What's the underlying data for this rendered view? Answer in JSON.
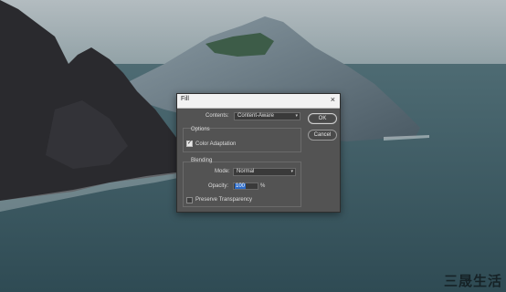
{
  "dialog": {
    "title": "Fill",
    "close_glyph": "×",
    "contents_label": "Contents:",
    "contents_value": "Content-Aware",
    "options_label": "Options",
    "color_adaptation_label": "Color Adaptation",
    "color_adaptation_checked": true,
    "blending_label": "Blending",
    "mode_label": "Mode:",
    "mode_value": "Normal",
    "opacity_label": "Opacity:",
    "opacity_value": "100",
    "opacity_unit": "%",
    "preserve_transparency_label": "Preserve Transparency",
    "preserve_transparency_checked": false,
    "ok_label": "OK",
    "cancel_label": "Cancel"
  },
  "watermark": {
    "text": "三晟生活"
  },
  "colors": {
    "sea": "#3d5a62",
    "sky": "#aab4b8",
    "dialog_bg": "#535353",
    "selection": "#2d6bc7"
  },
  "icons": {
    "close": "close-icon",
    "check": "checkmark-icon",
    "chevron": "chevron-down-icon"
  }
}
